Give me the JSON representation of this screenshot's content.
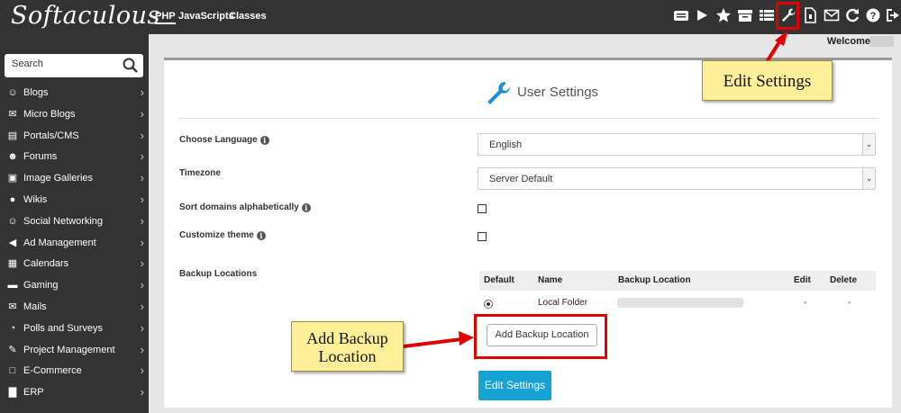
{
  "app": {
    "logo_text": "Softaculous"
  },
  "top_tabs": [
    {
      "label": "PHP",
      "active": true
    },
    {
      "label": "JavaScripts",
      "active": false
    },
    {
      "label": "Classes",
      "active": false
    }
  ],
  "top_icons": [
    "tasks-icon",
    "play-icon",
    "star-icon",
    "archive-icon",
    "list-icon",
    "wrench-icon",
    "document-icon",
    "mail-icon",
    "refresh-icon",
    "help-icon",
    "logout-icon"
  ],
  "welcome": {
    "label": "Welcome"
  },
  "search": {
    "placeholder": "Search"
  },
  "sidebar": {
    "items": [
      {
        "label": "Blogs",
        "icon": "user-icon"
      },
      {
        "label": "Micro Blogs",
        "icon": "comments-icon"
      },
      {
        "label": "Portals/CMS",
        "icon": "portal-icon"
      },
      {
        "label": "Forums",
        "icon": "users-icon"
      },
      {
        "label": "Image Galleries",
        "icon": "image-icon"
      },
      {
        "label": "Wikis",
        "icon": "globe-icon"
      },
      {
        "label": "Social Networking",
        "icon": "social-icon"
      },
      {
        "label": "Ad Management",
        "icon": "bullhorn-icon"
      },
      {
        "label": "Calendars",
        "icon": "calendar-icon"
      },
      {
        "label": "Gaming",
        "icon": "gamepad-icon"
      },
      {
        "label": "Mails",
        "icon": "envelope-icon"
      },
      {
        "label": "Polls and Surveys",
        "icon": "pie-chart-icon"
      },
      {
        "label": "Project Management",
        "icon": "edit-icon"
      },
      {
        "label": "E-Commerce",
        "icon": "cart-icon"
      },
      {
        "label": "ERP",
        "icon": "bar-chart-icon"
      }
    ]
  },
  "panel": {
    "title": "User Settings",
    "fields": {
      "language_label": "Choose Language",
      "language_value": "English",
      "timezone_label": "Timezone",
      "timezone_value": "Server Default",
      "sort_label": "Sort domains alphabetically",
      "theme_label": "Customize theme",
      "backup_label": "Backup Locations"
    },
    "backup_table": {
      "headers": [
        "Default",
        "Name",
        "Backup Location",
        "Edit",
        "Delete"
      ],
      "rows": [
        {
          "name": "Local Folder",
          "edit": "-",
          "delete": "-"
        }
      ]
    },
    "add_backup_button": "Add Backup Location",
    "edit_settings_button": "Edit Settings"
  },
  "callouts": {
    "edit_settings": "Edit Settings",
    "add_backup_line1": "Add Backup",
    "add_backup_line2": "Location"
  },
  "colors": {
    "topbar": "#333333",
    "sidebar": "#333333",
    "primary_button": "#17a2d4",
    "highlight": "#e00000",
    "callout_bg": "#ffef99"
  }
}
